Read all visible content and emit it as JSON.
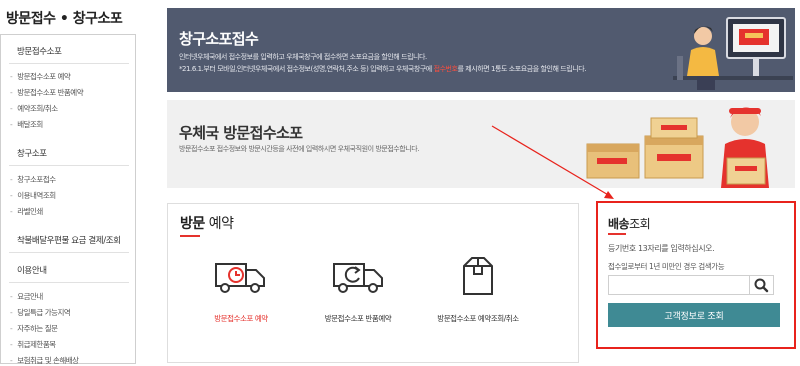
{
  "sidebar": {
    "title": "방문접수 • 창구소포",
    "groups": [
      {
        "label": "방문접수소포",
        "items": [
          "방문접수소포 예약",
          "방문접수소포 반품예약",
          "예약조회/취소",
          "배달조회"
        ]
      },
      {
        "label": "창구소포",
        "items": [
          "창구소포접수",
          "이용내역조회",
          "라벨인쇄"
        ]
      },
      {
        "label": "착불배달우편물 요금 결제/조회",
        "items": []
      },
      {
        "label": "이용안내",
        "items": [
          "요금안내",
          "당일특급 가능지역",
          "자주하는 질문",
          "취급제한품목",
          "보험취급 및 손해배상"
        ]
      }
    ]
  },
  "banner_counter": {
    "title": "창구소포접수",
    "line1": "인터넷우체국에서 접수정보를 입력하고 우체국창구에 접수하면 소포요금을 할인해 드립니다.",
    "line2_before": "*21.6.1.부터 모바일,인터넷우체국에서 접수정보(성명,연락처,주소 등) 입력하고 우체국창구에 ",
    "line2_highlight": "접수번호",
    "line2_after": "를 제시하면 1통도 소포요금을 할인해 드립니다."
  },
  "banner_visit": {
    "title": "우체국 방문접수소포",
    "desc": "방문접수소포 접수정보와 방문시간등을 사전에 입력하시면 우체국직원이 방문접수합니다."
  },
  "visit_section": {
    "title_bold": "방문",
    "title_rest": " 예약",
    "items": [
      {
        "label": "방문접수소포 예약",
        "icon": "truck-clock-icon",
        "color": "#e5322d"
      },
      {
        "label": "방문접수소포 반품예약",
        "icon": "truck-return-icon",
        "color": "#333333"
      },
      {
        "label": "방문접수소포 예약조회/취소",
        "icon": "box-icon",
        "color": "#333333"
      }
    ]
  },
  "tracking": {
    "title_bold": "배송",
    "title_rest": "조회",
    "instruction": "등기번호 13자리를 입력하십시오.",
    "note": "접수일로부터 1년 미만인 경우 검색가능",
    "input_value": "",
    "input_placeholder": "",
    "search_icon": "search-icon",
    "button_label": "고객정보로 조회"
  },
  "colors": {
    "accent_red": "#e5322d",
    "banner_dark": "#515a6f",
    "button_teal": "#3f8a94",
    "highlight_border": "#e8231c"
  }
}
